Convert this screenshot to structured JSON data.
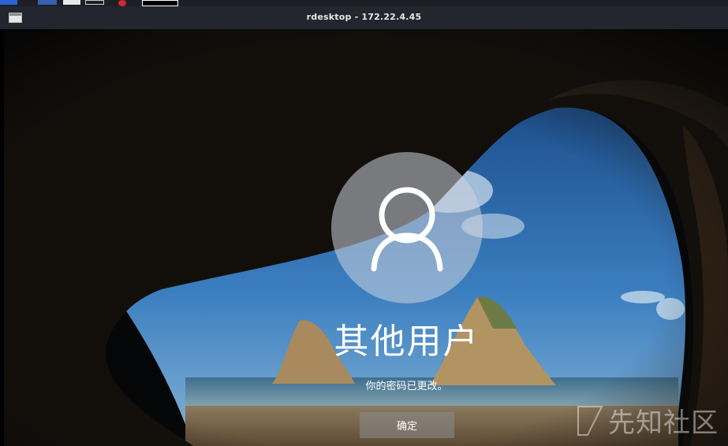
{
  "window": {
    "title": "rdesktop - 172.22.4.45",
    "icon": "window-icon"
  },
  "taskbar": {
    "icons": [
      "start-icon",
      "app-icon",
      "document-icon",
      "terminal-icon",
      "record-icon",
      "active-window-icon"
    ]
  },
  "login": {
    "avatar_icon": "user-icon",
    "username": "其他用户",
    "message": "你的密码已更改。",
    "ok_label": "确定"
  },
  "watermark": {
    "text": "先知社区"
  },
  "colors": {
    "titlebar": "#23262e",
    "sky": "#2f6fb0",
    "button": "#8c8c8c"
  }
}
